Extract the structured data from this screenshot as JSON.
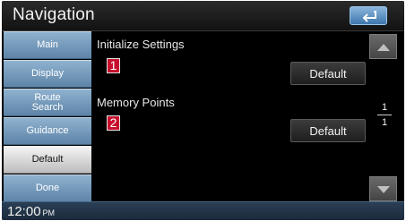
{
  "header": {
    "title": "Navigation"
  },
  "icons": {
    "back": "return-arrow-icon",
    "scroll_up": "triangle-up-icon",
    "scroll_down": "triangle-down-icon"
  },
  "sidebar": {
    "items": [
      {
        "label": "Main",
        "active": false
      },
      {
        "label": "Display",
        "active": false
      },
      {
        "label": "Route\nSearch",
        "active": false
      },
      {
        "label": "Guidance",
        "active": false
      },
      {
        "label": "Default",
        "active": true
      },
      {
        "label": "Done",
        "active": false
      }
    ]
  },
  "main": {
    "sections": [
      {
        "label": "Initialize Settings",
        "badge": "1",
        "button_label": "Default"
      },
      {
        "label": "Memory Points",
        "badge": "2",
        "button_label": "Default"
      }
    ]
  },
  "pagination": {
    "current": "1",
    "total": "1"
  },
  "status": {
    "time": "12:00",
    "ampm": "PM"
  },
  "colors": {
    "accent_blue": "#6f97bd",
    "badge_red": "#c8102e",
    "back_button": "#5a8fc4"
  }
}
